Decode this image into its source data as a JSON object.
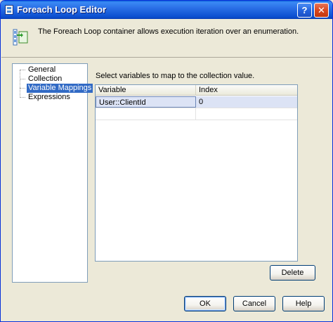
{
  "window": {
    "title": "Foreach Loop Editor",
    "help_glyph": "?",
    "close_glyph": "✕"
  },
  "header": {
    "description": "The Foreach Loop container allows execution iteration over an enumeration.",
    "icon": "foreach-loop-icon"
  },
  "nav": {
    "items": [
      {
        "label": "General",
        "selected": false
      },
      {
        "label": "Collection",
        "selected": false
      },
      {
        "label": "Variable Mappings",
        "selected": true
      },
      {
        "label": "Expressions",
        "selected": false
      }
    ]
  },
  "mappings": {
    "instruction": "Select variables to map to the collection value.",
    "columns": [
      "Variable",
      "Index"
    ],
    "rows": [
      {
        "variable": "User::ClientId",
        "index": "0"
      }
    ]
  },
  "buttons": {
    "delete": "Delete",
    "ok": "OK",
    "cancel": "Cancel",
    "help": "Help"
  },
  "colors": {
    "titlebar": "#0a5fd8",
    "selection": "#316ac5",
    "face": "#ece9d8"
  }
}
